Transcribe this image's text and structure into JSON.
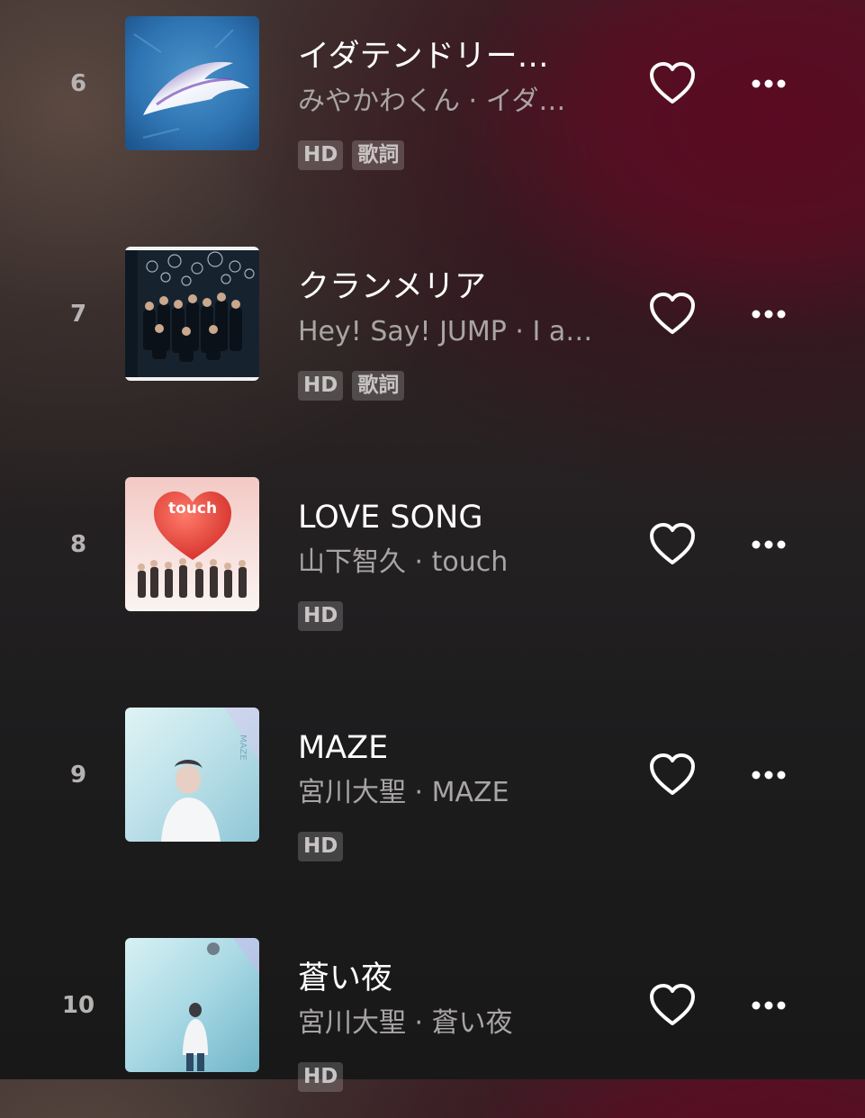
{
  "tracks": [
    {
      "rank": "6",
      "title": "イダテンドリー…",
      "subtitle": "みやかわくん · イダ…",
      "badges": [
        "HD",
        "歌詞"
      ]
    },
    {
      "rank": "7",
      "title": "クランメリア",
      "subtitle": "Hey! Say! JUMP · I a…",
      "badges": [
        "HD",
        "歌詞"
      ]
    },
    {
      "rank": "8",
      "title": "LOVE SONG",
      "subtitle": "山下智久 · touch",
      "badges": [
        "HD"
      ],
      "art_text": "touch"
    },
    {
      "rank": "9",
      "title": "MAZE",
      "subtitle": "宮川大聖 · MAZE",
      "badges": [
        "HD"
      ]
    },
    {
      "rank": "10",
      "title": "蒼い夜",
      "subtitle": "宮川大聖 · 蒼い夜",
      "badges": [
        "HD"
      ]
    }
  ],
  "icons": {
    "like": "heart-outline-icon",
    "more": "more-horizontal-icon"
  },
  "colors": {
    "title": "#ffffff",
    "subtitle": "#a9a5a5",
    "rank": "#b7b3b3",
    "badge_bg": "rgba(255,255,255,0.18)",
    "accent_maroon": "#5a0a22"
  }
}
